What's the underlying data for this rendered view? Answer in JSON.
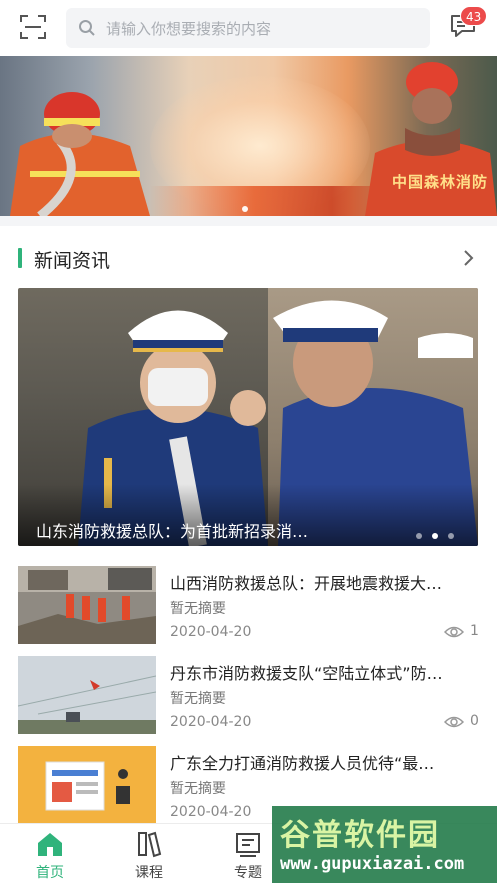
{
  "search": {
    "placeholder": "请输入你想要搜索的内容"
  },
  "messages": {
    "badge_count": "43"
  },
  "banner": {
    "right_text": "中国森林消防",
    "dots_count": 1
  },
  "section": {
    "title": "新闻资讯"
  },
  "featured": {
    "caption": "山东消防救援总队：为首批新招录消…",
    "dots_total": 4,
    "active_dot": 1
  },
  "news": [
    {
      "title": "山西消防救援总队：开展地震救援大…",
      "summary": "暂无摘要",
      "date": "2020-04-20",
      "views": "1"
    },
    {
      "title": "丹东市消防救援支队“空陆立体式”防…",
      "summary": "暂无摘要",
      "date": "2020-04-20",
      "views": "0"
    },
    {
      "title": "广东全力打通消防救援人员优待“最…",
      "summary": "暂无摘要",
      "date": "2020-04-20",
      "views": ""
    }
  ],
  "tabs": [
    {
      "label": "首页",
      "icon": "home-icon",
      "active": true
    },
    {
      "label": "课程",
      "icon": "course-icon",
      "active": false
    },
    {
      "label": "专题",
      "icon": "topic-icon",
      "active": false
    }
  ],
  "watermark": {
    "main": "谷普软件园",
    "url": "www.gupuxiazai.com"
  },
  "colors": {
    "accent": "#2fb37b",
    "badge": "#ec4b4b"
  }
}
